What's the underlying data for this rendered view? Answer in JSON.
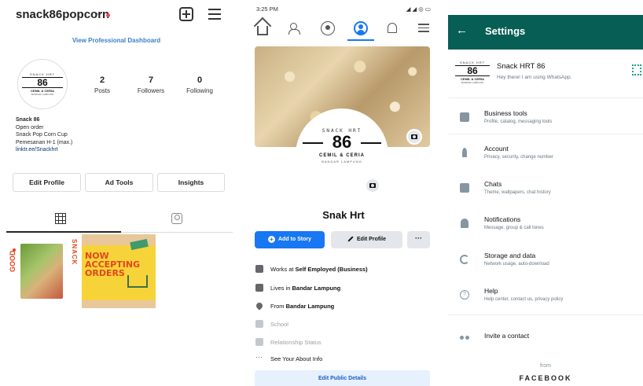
{
  "instagram": {
    "username": "snack86popcorn",
    "professional_dashboard": "View Professional Dashboard",
    "avatar_logo": {
      "top": "SNACK HRT",
      "number": "86",
      "line": "CEMIL & CERIA",
      "sub": "BANDAR LAMPUNG"
    },
    "stats": [
      {
        "value": "2",
        "label": "Posts"
      },
      {
        "value": "7",
        "label": "Followers"
      },
      {
        "value": "0",
        "label": "Following"
      }
    ],
    "bio": {
      "name": "Snack 86",
      "lines": [
        "Open order",
        "Snack Pop Corn Cup",
        "Pemesanan H-1 (max.)"
      ],
      "link": "linktr.ee/Snackhrt"
    },
    "buttons": {
      "edit_profile": "Edit Profile",
      "ad_tools": "Ad Tools",
      "insights": "Insights"
    },
    "posts": {
      "post1": {
        "left_text": "GOOD",
        "right_text": "SNACK"
      },
      "post2": {
        "headline_1": "NOW",
        "headline_2": "ACCEPTING",
        "headline_3": "ORDERS"
      }
    }
  },
  "facebook": {
    "status_time": "3:25 PM",
    "status_right": "◢ ◢ ◎ ▭",
    "cover_logo": {
      "top": "SNACK HRT",
      "number": "86",
      "line": "CEMIL & CERIA",
      "sub": "BANDAR LAMPUNG"
    },
    "name": "Snak Hrt",
    "add_to_story": "Add to Story",
    "edit_profile": "Edit Profile",
    "more": "···",
    "about": {
      "work_prefix": "Works at ",
      "work": "Self Employed (Business)",
      "lives_prefix": "Lives in ",
      "lives": "Bandar Lampung",
      "from_prefix": "From ",
      "from": "Bandar Lampung",
      "school": "School",
      "relationship": "Relationship Status",
      "see_about": "See Your About Info"
    },
    "edit_public_details": "Edit Public Details"
  },
  "whatsapp": {
    "title": "Settings",
    "back": "←",
    "profile": {
      "name": "Snack HRT 86",
      "status": "Hey there! I am using WhatsApp."
    },
    "avatar_logo": {
      "top": "SNACK HRT",
      "number": "86",
      "line": "CEMIL & CERIA",
      "sub": "BANDAR LAMPUNG"
    },
    "items": [
      {
        "title": "Business tools",
        "subtitle": "Profile, catalog, messaging tools"
      },
      {
        "title": "Account",
        "subtitle": "Privacy, security, change number"
      },
      {
        "title": "Chats",
        "subtitle": "Theme, wallpapers, chat history"
      },
      {
        "title": "Notifications",
        "subtitle": "Message, group & call tones"
      },
      {
        "title": "Storage and data",
        "subtitle": "Network usage, auto-download"
      },
      {
        "title": "Help",
        "subtitle": "Help center, contact us, privacy policy"
      }
    ],
    "invite": "Invite a contact",
    "from": "from",
    "facebook": "FACEBOOK"
  },
  "colors": {
    "ig_link": "#3a80c9",
    "fb_blue": "#1877f2",
    "wa_green": "#075e54"
  }
}
